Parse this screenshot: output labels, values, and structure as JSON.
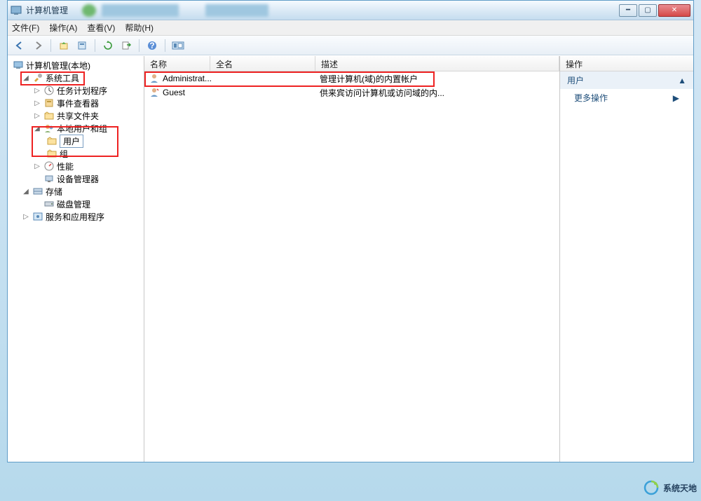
{
  "window": {
    "title": "计算机管理"
  },
  "menu": {
    "file": "文件(F)",
    "action": "操作(A)",
    "view": "查看(V)",
    "help": "帮助(H)"
  },
  "tree": {
    "root": "计算机管理(本地)",
    "system_tools": "系统工具",
    "task_scheduler": "任务计划程序",
    "event_viewer": "事件查看器",
    "shared_folders": "共享文件夹",
    "local_users_groups": "本地用户和组",
    "users": "用户",
    "groups": "组",
    "performance": "性能",
    "device_manager": "设备管理器",
    "storage": "存储",
    "disk_management": "磁盘管理",
    "services_apps": "服务和应用程序"
  },
  "list": {
    "col_name": "名称",
    "col_fullname": "全名",
    "col_description": "描述",
    "rows": [
      {
        "name": "Administrat...",
        "fullname": "",
        "description": "管理计算机(域)的内置帐户"
      },
      {
        "name": "Guest",
        "fullname": "",
        "description": "供来宾访问计算机或访问域的内..."
      }
    ]
  },
  "actions": {
    "header": "操作",
    "section_title": "用户",
    "more_actions": "更多操作"
  },
  "watermark": "系统天地"
}
